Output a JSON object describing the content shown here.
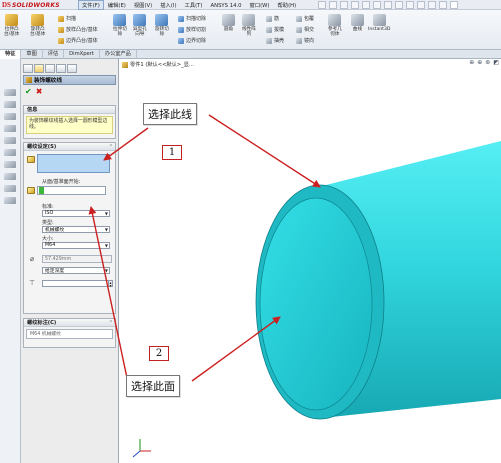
{
  "app": {
    "logo_mark": "DS",
    "brand": "SOLIDWORKS"
  },
  "menu": {
    "items": [
      "文件(F)",
      "编辑(E)",
      "视图(V)",
      "插入(I)",
      "工具(T)",
      "ANSYS 14.0",
      "窗口(W)",
      "帮助(H)"
    ]
  },
  "ribbon": {
    "extrude_boss": "拉伸凸\n台/基体",
    "revolve_boss": "旋转凸\n台/基体",
    "sweep": "扫描",
    "loft_boss": "放样凸台/基体",
    "boundary_boss": "边界凸台/基体",
    "extrude_cut": "拉伸切\n除",
    "hole_wizard": "异型孔\n向导",
    "revolve_cut": "旋转切\n除",
    "sweep_cut": "扫描切除",
    "loft_cut": "放样切割",
    "boundary_cut": "边界切除",
    "fillet": "圆角",
    "linear_pattern": "线性阵\n列",
    "rib": "筋",
    "wrap": "包覆",
    "draft": "拔模",
    "intersect": "相交",
    "shell": "抽壳",
    "mirror": "镜向",
    "reference_geometry": "参考几\n何体",
    "curves": "曲线",
    "instant3d": "Instant3D"
  },
  "cm_tabs": [
    "特征",
    "草图",
    "评估",
    "DimXpert",
    "办公室产品"
  ],
  "property_manager": {
    "title": "装饰螺纹线",
    "ok": "✔",
    "cancel": "✖",
    "info_group": {
      "title": "信息",
      "message": "为装饰螺纹线插入选择一圆形模型边线。"
    },
    "settings_group": {
      "title": "螺纹设定(S)",
      "start_label": "从面/基准面开始:",
      "standard_label": "标准:",
      "standard_value": "ISO",
      "type_label": "类型:",
      "type_value": "机械螺纹",
      "size_label": "大小:",
      "size_value": "M64",
      "diameter_value": "57.429mm",
      "end_condition_value": "给定深度"
    },
    "callout_group": {
      "title": "螺纹标注(C)",
      "value": "M64 机械螺纹"
    }
  },
  "viewport": {
    "breadcrumb": "零件1 (默认<<默认>_显..."
  },
  "annotations": {
    "select_edge": "选择此线",
    "select_face": "选择此面",
    "step1": "1",
    "step2": "2"
  },
  "colors": {
    "part_face": "#29d7dd",
    "arrow": "#cc1f1f",
    "selection_box": "#b5d7f3"
  }
}
